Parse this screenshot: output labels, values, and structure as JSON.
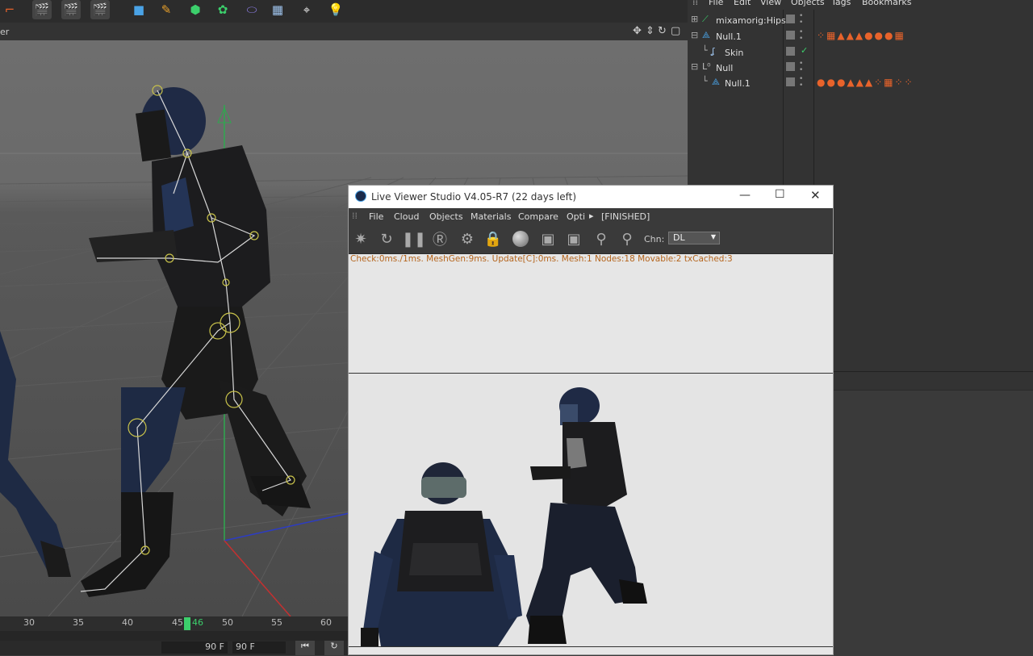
{
  "viewport": {
    "header_label": "er"
  },
  "timeline": {
    "ticks": [
      "30",
      "35",
      "40",
      "45",
      "50",
      "55",
      "60"
    ],
    "current_frame": "46",
    "end_frame_field": "90 F",
    "max_frame_field": "90 F"
  },
  "object_manager": {
    "menu": [
      "File",
      "Edit",
      "View",
      "Objects",
      "Tags",
      "Bookmarks"
    ],
    "rows": [
      {
        "name": "mixamorig:Hips"
      },
      {
        "name": "Null.1"
      },
      {
        "name": "Skin"
      },
      {
        "name": "Null"
      },
      {
        "name": "Null.1"
      }
    ]
  },
  "live_viewer": {
    "title": "Live Viewer Studio V4.05-R7 (22 days left)",
    "menu": [
      "File",
      "Cloud",
      "Objects",
      "Materials",
      "Compare",
      "Opti"
    ],
    "menu_more": "▸",
    "state": "[FINISHED]",
    "channel_label": "Chn:",
    "channel_value": "DL",
    "status": "Check:0ms./1ms. MeshGen:9ms. Update[C]:0ms. Mesh:1 Nodes:18 Movable:2 txCached:3"
  },
  "colors": {
    "accent_orange": "#e8632b",
    "status_text": "#b5651d",
    "timeline_marker": "#3ccf6c"
  }
}
